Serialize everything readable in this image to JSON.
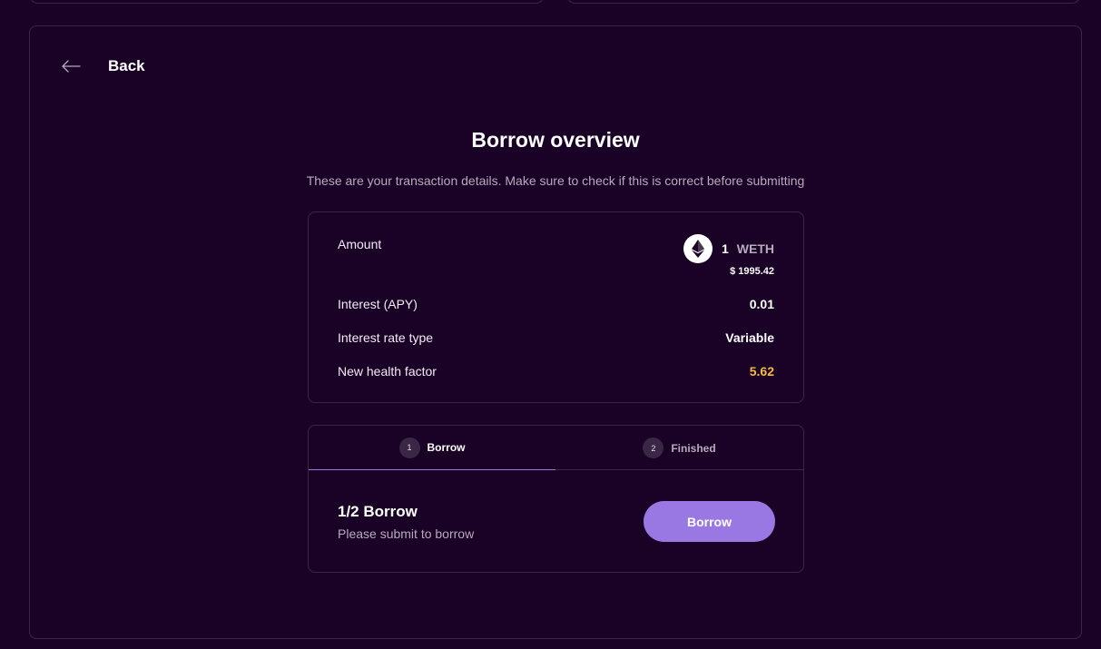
{
  "back": {
    "label": "Back"
  },
  "overview": {
    "title": "Borrow overview",
    "subtitle": "These are your transaction details. Make sure to check if this is correct before submitting"
  },
  "details": {
    "amount_label": "Amount",
    "amount_value": "1",
    "amount_symbol": "WETH",
    "amount_usd": "$ 1995.42",
    "token_icon": "ethereum-icon",
    "interest_label": "Interest (APY)",
    "interest_value": "0.01",
    "rate_type_label": "Interest rate type",
    "rate_type_value": "Variable",
    "health_label": "New health factor",
    "health_value": "5.62",
    "health_color": "#f5b944"
  },
  "steps": {
    "tabs": [
      {
        "num": "1",
        "label": "Borrow"
      },
      {
        "num": "2",
        "label": "Finished"
      }
    ],
    "current_title": "1/2 Borrow",
    "current_desc": "Please submit to borrow",
    "button_label": "Borrow",
    "accent_color": "#9a78e4"
  }
}
